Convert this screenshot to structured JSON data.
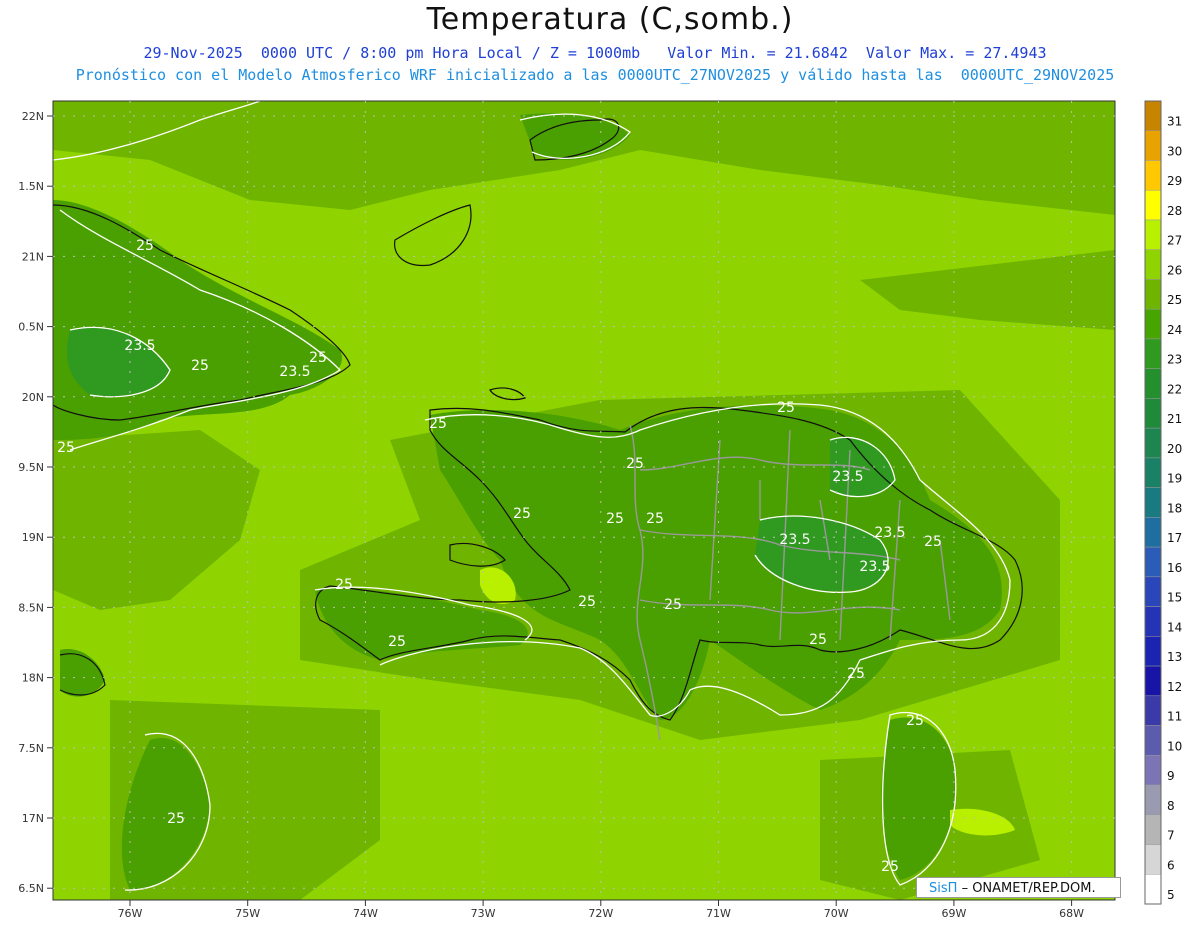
{
  "title": "Temperatura (C,somb.)",
  "subtitle_line1": "29-Nov-2025  0000 UTC / 8:00 pm Hora Local / Z = 1000mb   Valor Min. = 21.6842  Valor Max. = 27.4943",
  "subtitle_line2": "Pronóstico con el Modelo Atmosferico WRF inicializado a las 0000UTC_27NOV2025 y válido hasta las  0000UTC_29NOV2025",
  "credit": {
    "brand": "SisΠ",
    "text": "– ONAMET/REP.DOM."
  },
  "map": {
    "lat_labels": [
      "22N",
      "1.5N",
      "21N",
      "0.5N",
      "20N",
      "9.5N",
      "19N",
      "8.5N",
      "18N",
      "7.5N",
      "17N",
      "6.5N"
    ],
    "lon_labels": [
      "76W",
      "75W",
      "74W",
      "73W",
      "72W",
      "71W",
      "70W",
      "69W",
      "68W"
    ],
    "contour_labels": [
      "25",
      "23.5",
      "25",
      "23.5",
      "25",
      "25",
      "25",
      "25",
      "23.5",
      "25",
      "25",
      "25",
      "23.5",
      "23.5",
      "25",
      "23.5",
      "25",
      "25",
      "25",
      "25",
      "25",
      "25",
      "25",
      "25",
      "25",
      "25"
    ],
    "colors": {
      "t26": "#6fb500",
      "t25": "#8fd400",
      "t24": "#4aa000",
      "t23": "#2f9a1f",
      "t27": "#b8f000"
    }
  },
  "colorbar": {
    "labels": [
      "31",
      "30",
      "29",
      "28",
      "27",
      "26",
      "25",
      "24",
      "23",
      "22",
      "21",
      "20",
      "19",
      "18",
      "17",
      "16",
      "15",
      "14",
      "13",
      "12",
      "11",
      "10",
      "9",
      "8",
      "7",
      "6",
      "5"
    ],
    "colors": [
      "#c78400",
      "#e8a300",
      "#ffc800",
      "#ffff00",
      "#b8f000",
      "#8fd400",
      "#6fb500",
      "#46a500",
      "#2f9a1f",
      "#24902d",
      "#1f8a3a",
      "#1c8550",
      "#1a8066",
      "#197a82",
      "#1e6fa0",
      "#2a5cb8",
      "#2a46b8",
      "#2434b5",
      "#1b24b0",
      "#1714a6",
      "#3a3aa8",
      "#5c5caf",
      "#7d74b5",
      "#9a9ab0",
      "#b5b5b5",
      "#d6d6d6",
      "#ffffff"
    ]
  }
}
